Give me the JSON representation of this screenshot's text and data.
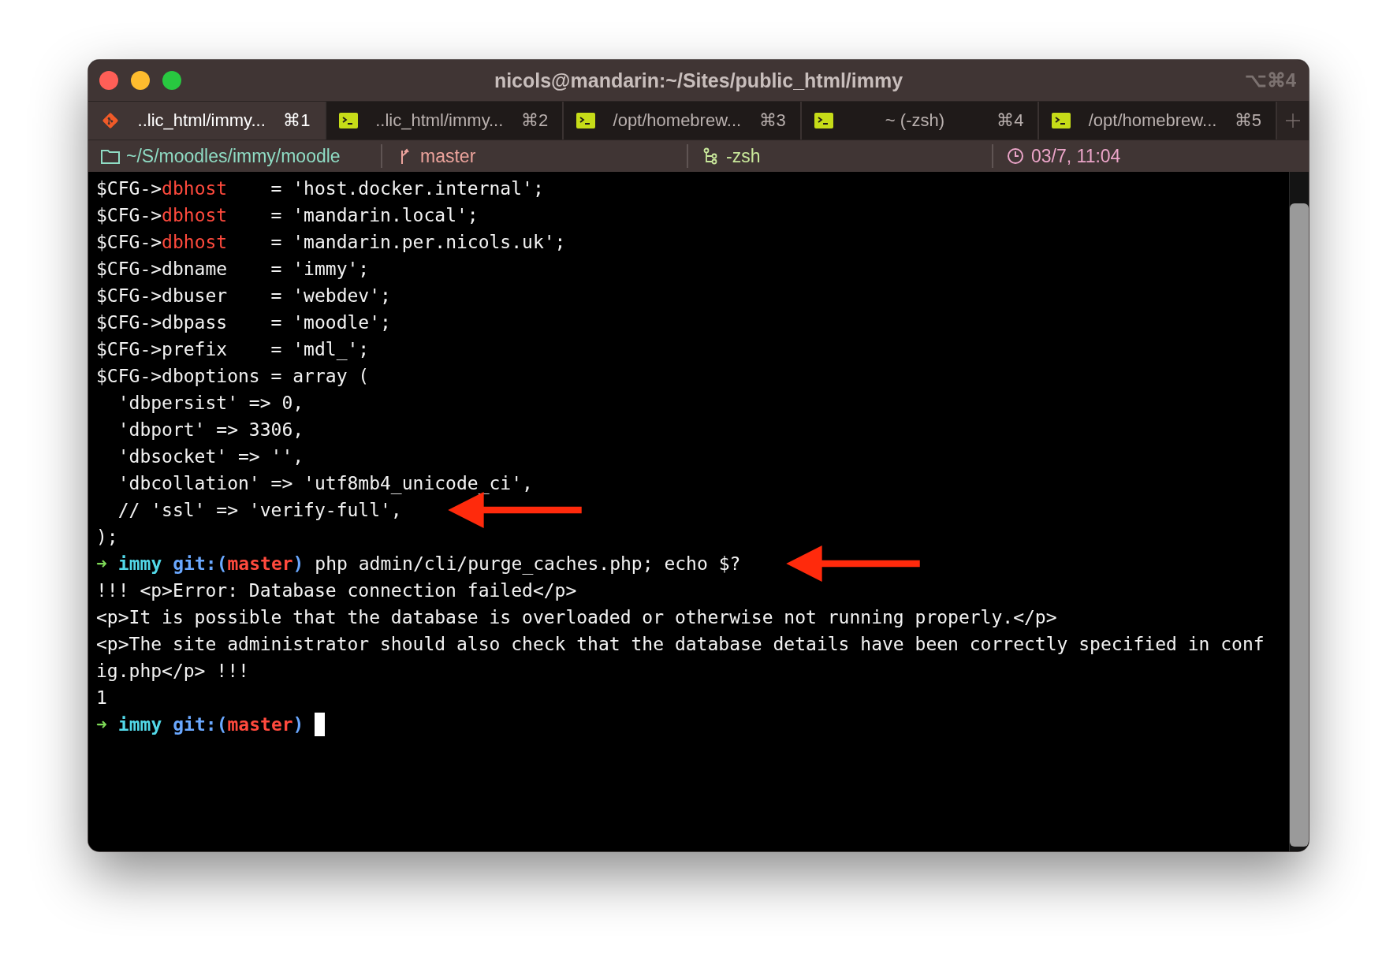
{
  "window": {
    "title": "nicols@mandarin:~/Sites/public_html/immy",
    "shortcut": "⌥⌘4"
  },
  "tabs": [
    {
      "kind": "git",
      "label": "..lic_html/immy...",
      "shortcut": "⌘1",
      "selected": true
    },
    {
      "kind": "shell",
      "label": "..lic_html/immy...",
      "shortcut": "⌘2",
      "selected": false
    },
    {
      "kind": "shell",
      "label": "/opt/homebrew...",
      "shortcut": "⌘3",
      "selected": false
    },
    {
      "kind": "shell",
      "label": "~ (-zsh)",
      "shortcut": "⌘4",
      "selected": false
    },
    {
      "kind": "shell",
      "label": "/opt/homebrew...",
      "shortcut": "⌘5",
      "selected": false
    }
  ],
  "status_bar": [
    {
      "kind": "folder",
      "text": "~/S/moodles/immy/moodle",
      "color": "#8fdcc4"
    },
    {
      "kind": "branch",
      "text": "master",
      "color": "#eca39c"
    },
    {
      "kind": "process",
      "text": "-zsh",
      "color": "#c9e89b"
    },
    {
      "kind": "clock",
      "text": "03/7, 11:04",
      "color": "#eca5c9"
    }
  ],
  "terminal": {
    "lines": [
      {
        "segments": [
          {
            "kind": "plain",
            "text": "$CFG->"
          },
          {
            "kind": "keyword",
            "text": "dbhost"
          },
          {
            "kind": "plain",
            "text": "    = 'host.docker.internal';"
          }
        ]
      },
      {
        "segments": [
          {
            "kind": "plain",
            "text": "$CFG->"
          },
          {
            "kind": "keyword",
            "text": "dbhost"
          },
          {
            "kind": "plain",
            "text": "    = 'mandarin.local';"
          }
        ]
      },
      {
        "segments": [
          {
            "kind": "plain",
            "text": "$CFG->"
          },
          {
            "kind": "keyword",
            "text": "dbhost"
          },
          {
            "kind": "plain",
            "text": "    = 'mandarin.per.nicols.uk';"
          }
        ]
      },
      {
        "segments": [
          {
            "kind": "plain",
            "text": "$CFG->dbname    = 'immy';"
          }
        ]
      },
      {
        "segments": [
          {
            "kind": "plain",
            "text": "$CFG->dbuser    = 'webdev';"
          }
        ]
      },
      {
        "segments": [
          {
            "kind": "plain",
            "text": "$CFG->dbpass    = 'moodle';"
          }
        ]
      },
      {
        "segments": [
          {
            "kind": "plain",
            "text": "$CFG->prefix    = 'mdl_';"
          }
        ]
      },
      {
        "segments": [
          {
            "kind": "plain",
            "text": "$CFG->dboptions = array ("
          }
        ]
      },
      {
        "segments": [
          {
            "kind": "plain",
            "text": "  'dbpersist' => 0,"
          }
        ]
      },
      {
        "segments": [
          {
            "kind": "plain",
            "text": "  'dbport' => 3306,"
          }
        ]
      },
      {
        "segments": [
          {
            "kind": "plain",
            "text": "  'dbsocket' => '',"
          }
        ]
      },
      {
        "segments": [
          {
            "kind": "plain",
            "text": "  'dbcollation' => 'utf8mb4_unicode_ci',"
          }
        ]
      },
      {
        "segments": [
          {
            "kind": "plain",
            "text": "  // 'ssl' => 'verify-full',"
          }
        ],
        "arrow": true
      },
      {
        "segments": [
          {
            "kind": "plain",
            "text": ");"
          }
        ]
      },
      {
        "segments": [
          {
            "kind": "arrow",
            "text": "➜"
          },
          {
            "kind": "dir",
            "text": "immy"
          },
          {
            "kind": "git",
            "text": "git:("
          },
          {
            "kind": "branch",
            "text": "master"
          },
          {
            "kind": "git",
            "text": ")"
          },
          {
            "kind": "plain",
            "text": " php admin/cli/purge_caches.php; echo $?"
          }
        ],
        "arrow": true
      },
      {
        "segments": [
          {
            "kind": "plain",
            "text": "!!! <p>Error: Database connection failed</p>"
          }
        ]
      },
      {
        "segments": [
          {
            "kind": "plain",
            "text": "<p>It is possible that the database is overloaded or otherwise not running properly.</p>"
          }
        ]
      },
      {
        "segments": [
          {
            "kind": "plain",
            "text": "<p>The site administrator should also check that the database details have been correctly specified in conf"
          }
        ]
      },
      {
        "segments": [
          {
            "kind": "plain",
            "text": "ig.php</p> !!!"
          }
        ]
      },
      {
        "segments": [
          {
            "kind": "plain",
            "text": "1"
          }
        ]
      },
      {
        "segments": [
          {
            "kind": "arrow",
            "text": "➜"
          },
          {
            "kind": "dir",
            "text": "immy"
          },
          {
            "kind": "git",
            "text": "git:("
          },
          {
            "kind": "branch",
            "text": "master"
          },
          {
            "kind": "git",
            "text": ")"
          }
        ],
        "cursor": true
      }
    ]
  }
}
